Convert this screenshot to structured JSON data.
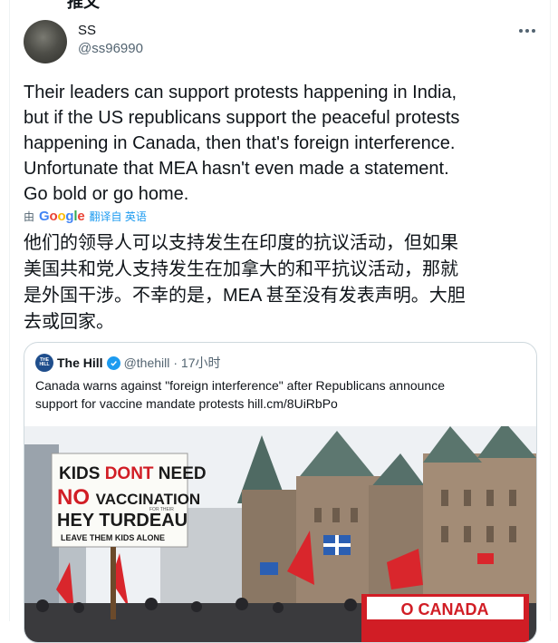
{
  "header": {
    "title_fragment": "推文"
  },
  "author": {
    "name": "SS",
    "handle": "@ss96990"
  },
  "tweet": {
    "lines": [
      "Their leaders can support protests happening in India,",
      "but if the US republicans support the peaceful protests",
      "happening in Canada, then that's foreign interference.",
      "Unfortunate that MEA hasn't even made a statement.",
      "Go bold or go home."
    ]
  },
  "translate": {
    "by": "由",
    "provider": "Google",
    "translated_label": "翻译自 英语"
  },
  "translated": {
    "lines": [
      "他们的领导人可以支持发生在印度的抗议活动，但如果",
      "美国共和党人支持发生在加拿大的和平抗议活动，那就",
      "是外国干涉。不幸的是，MEA 甚至没有发表声明。大胆",
      "去或回家。"
    ]
  },
  "quoted": {
    "logo_text": "THE HILL",
    "name": "The Hill",
    "handle": "@thehill",
    "time": "· 17小时",
    "text_lines": [
      "Canada warns against \"foreign interference\" after Republicans announce",
      "support for vaccine mandate protests hill.cm/8UiRbPo"
    ],
    "photo": {
      "sign_lines": [
        "KIDS DONT NEED",
        "NO VACCINATION",
        "HEY TURDEAU",
        "LEAVE THEM KIDS ALONE"
      ],
      "sign_scribble": "FOR THEIR",
      "banner": "O CANADA"
    }
  }
}
